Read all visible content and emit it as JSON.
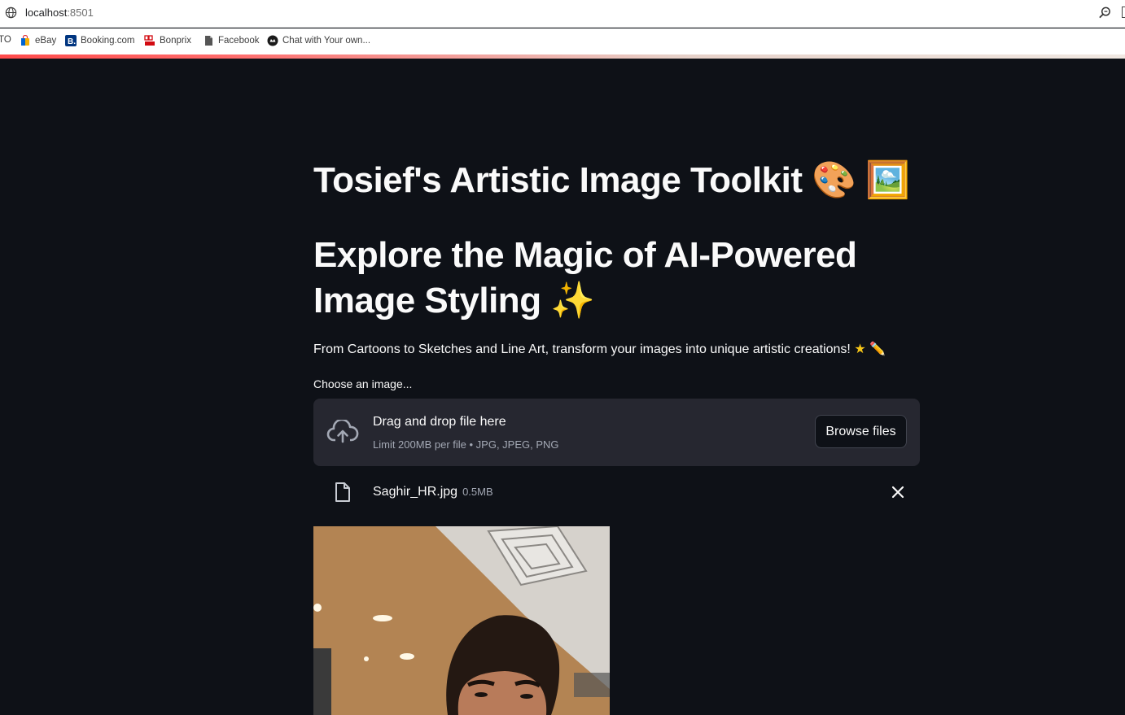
{
  "browser": {
    "url_host": "localhost",
    "url_port": ":8501",
    "bookmarks": [
      {
        "label": "TO",
        "icon": "cut-off-icon"
      },
      {
        "label": "eBay",
        "icon": "shopping-bag-icon"
      },
      {
        "label": "Booking.com",
        "icon": "booking-b-icon"
      },
      {
        "label": "Bonprix",
        "icon": "bonprix-icon"
      },
      {
        "label": "Facebook",
        "icon": "document-icon"
      },
      {
        "label": "Chat with Your own...",
        "icon": "chat-logo-icon"
      }
    ],
    "progress_color": "#ff4b4b"
  },
  "app": {
    "title": "Tosief's Artistic Image Toolkit 🎨 🖼️",
    "subtitle": "Explore the Magic of AI-Powered Image Styling ✨",
    "description": "From Cartoons to Sketches and Line Art, transform your images into unique artistic creations! ",
    "description_star": "★",
    "description_pencil": "✏️",
    "uploader": {
      "label": "Choose an image...",
      "drop_title": "Drag and drop file here",
      "drop_limit": "Limit 200MB per file • JPG, JPEG, PNG",
      "browse_label": "Browse files"
    },
    "uploaded_file": {
      "name": "Saghir_HR.jpg",
      "size": "0.5MB"
    },
    "colors": {
      "background": "#0e1117",
      "panel": "#262730",
      "text": "#fafafa",
      "muted": "#a3a8b4"
    }
  }
}
